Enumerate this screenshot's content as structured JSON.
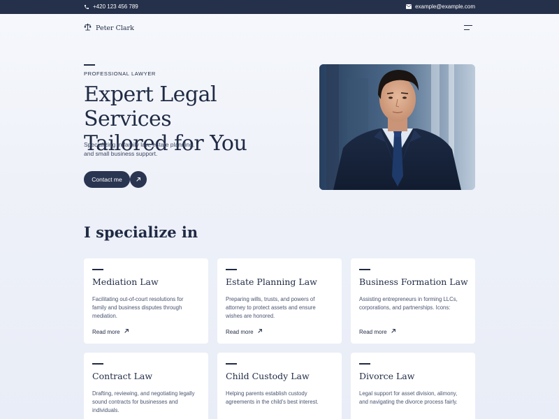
{
  "topbar": {
    "phone": "+420 123 456 789",
    "email": "example@example.com",
    "phone_icon": "phone-icon",
    "email_icon": "mail-icon"
  },
  "header": {
    "brand_name": "Peter Clark",
    "logo_icon": "scales-of-justice-icon",
    "menu_icon": "hamburger-menu-icon"
  },
  "hero": {
    "eyebrow": "PROFESSIONAL LAWYER",
    "title_line1": "Expert Legal Services",
    "title_line2": "Tailored for You",
    "text_line1": "Specializing in family law, estate planning,",
    "text_line2": "and small business support.",
    "cta_label": "Contact me",
    "cta_icon": "arrow-up-right-icon"
  },
  "services": {
    "title": "I specialize in",
    "read_more": "Read more",
    "cards": [
      {
        "title": "Mediation Law",
        "lines": [
          "Facilitating out-of-court resolutions for",
          "family and business disputes through",
          "mediation."
        ],
        "has_link": true
      },
      {
        "title": "Estate Planning Law",
        "lines": [
          "Preparing wills, trusts, and powers of",
          "attorney to protect assets and ensure",
          "wishes are honored."
        ],
        "has_link": true
      },
      {
        "title": "Business Formation Law",
        "lines": [
          "Assisting entrepreneurs in forming LLCs,",
          "corporations, and partnerships. Icons:"
        ],
        "has_link": true
      },
      {
        "title": "Contract Law",
        "lines": [
          "Drafting, reviewing, and negotiating legally",
          "sound contracts for businesses and",
          "individuals."
        ],
        "has_link": false
      },
      {
        "title": "Child Custody Law",
        "lines": [
          "Helping parents establish custody",
          "agreements in the child's best interest."
        ],
        "has_link": false
      },
      {
        "title": "Divorce Law",
        "lines": [
          "Legal support for asset division, alimony,",
          "and navigating the divorce process fairly."
        ],
        "has_link": false
      }
    ]
  },
  "colors": {
    "primary": "#25304a",
    "button": "#2a3552",
    "card_bg": "#ffffff"
  }
}
